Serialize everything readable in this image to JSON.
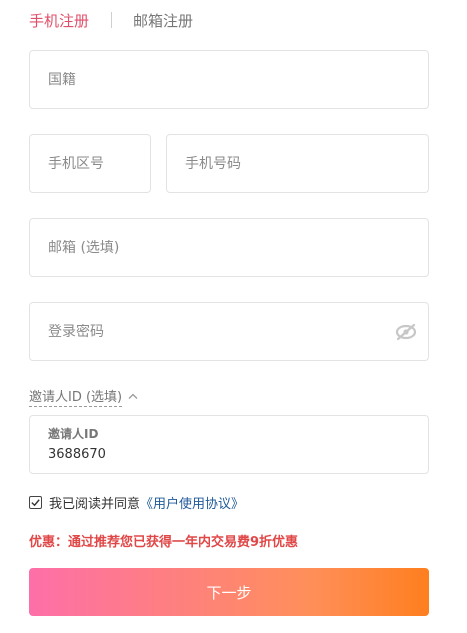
{
  "tabs": {
    "phone": "手机注册",
    "email": "邮箱注册"
  },
  "form": {
    "nationality_placeholder": "国籍",
    "area_code_placeholder": "手机区号",
    "phone_placeholder": "手机号码",
    "email_placeholder": "邮箱 (选填)",
    "password_placeholder": "登录密码",
    "inviter_toggle_label": "邀请人ID (选填)",
    "inviter_field_label": "邀请人ID",
    "inviter_value": "3688670"
  },
  "agreement": {
    "checked": true,
    "text": "我已阅读并同意",
    "link": "《用户使用协议》"
  },
  "promo": "优惠：通过推荐您已获得一年内交易费9折优惠",
  "next_button": "下一步",
  "colors": {
    "accent": "#e04f6a",
    "link": "#1f5a99",
    "promo": "#e04848",
    "btn_start": "#fd6fa8",
    "btn_end": "#ff7f1f"
  }
}
